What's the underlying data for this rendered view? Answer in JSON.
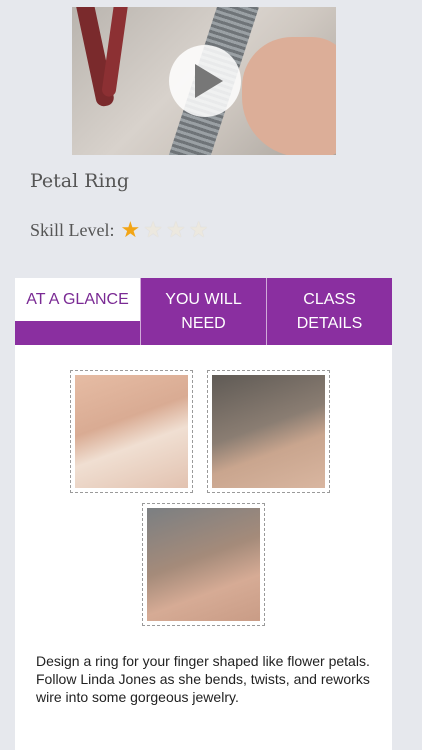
{
  "video": {
    "play_label": "Play video"
  },
  "class": {
    "title": "Petal Ring",
    "skill_label": "Skill Level:",
    "skill_rating": 1,
    "skill_max": 4
  },
  "tabs": [
    {
      "label": "AT A GLANCE",
      "active": true
    },
    {
      "label": "YOU WILL NEED",
      "active": false
    },
    {
      "label": "CLASS DETAILS",
      "active": false
    }
  ],
  "description": "Design a ring for your finger shaped like flower petals. Follow Linda Jones as she bends, twists, and reworks wire into some gorgeous jewelry.",
  "colors": {
    "accent": "#8a2fa0",
    "star_on": "#f2a516",
    "star_off": "#ece8df",
    "background": "#e6e8ed"
  }
}
